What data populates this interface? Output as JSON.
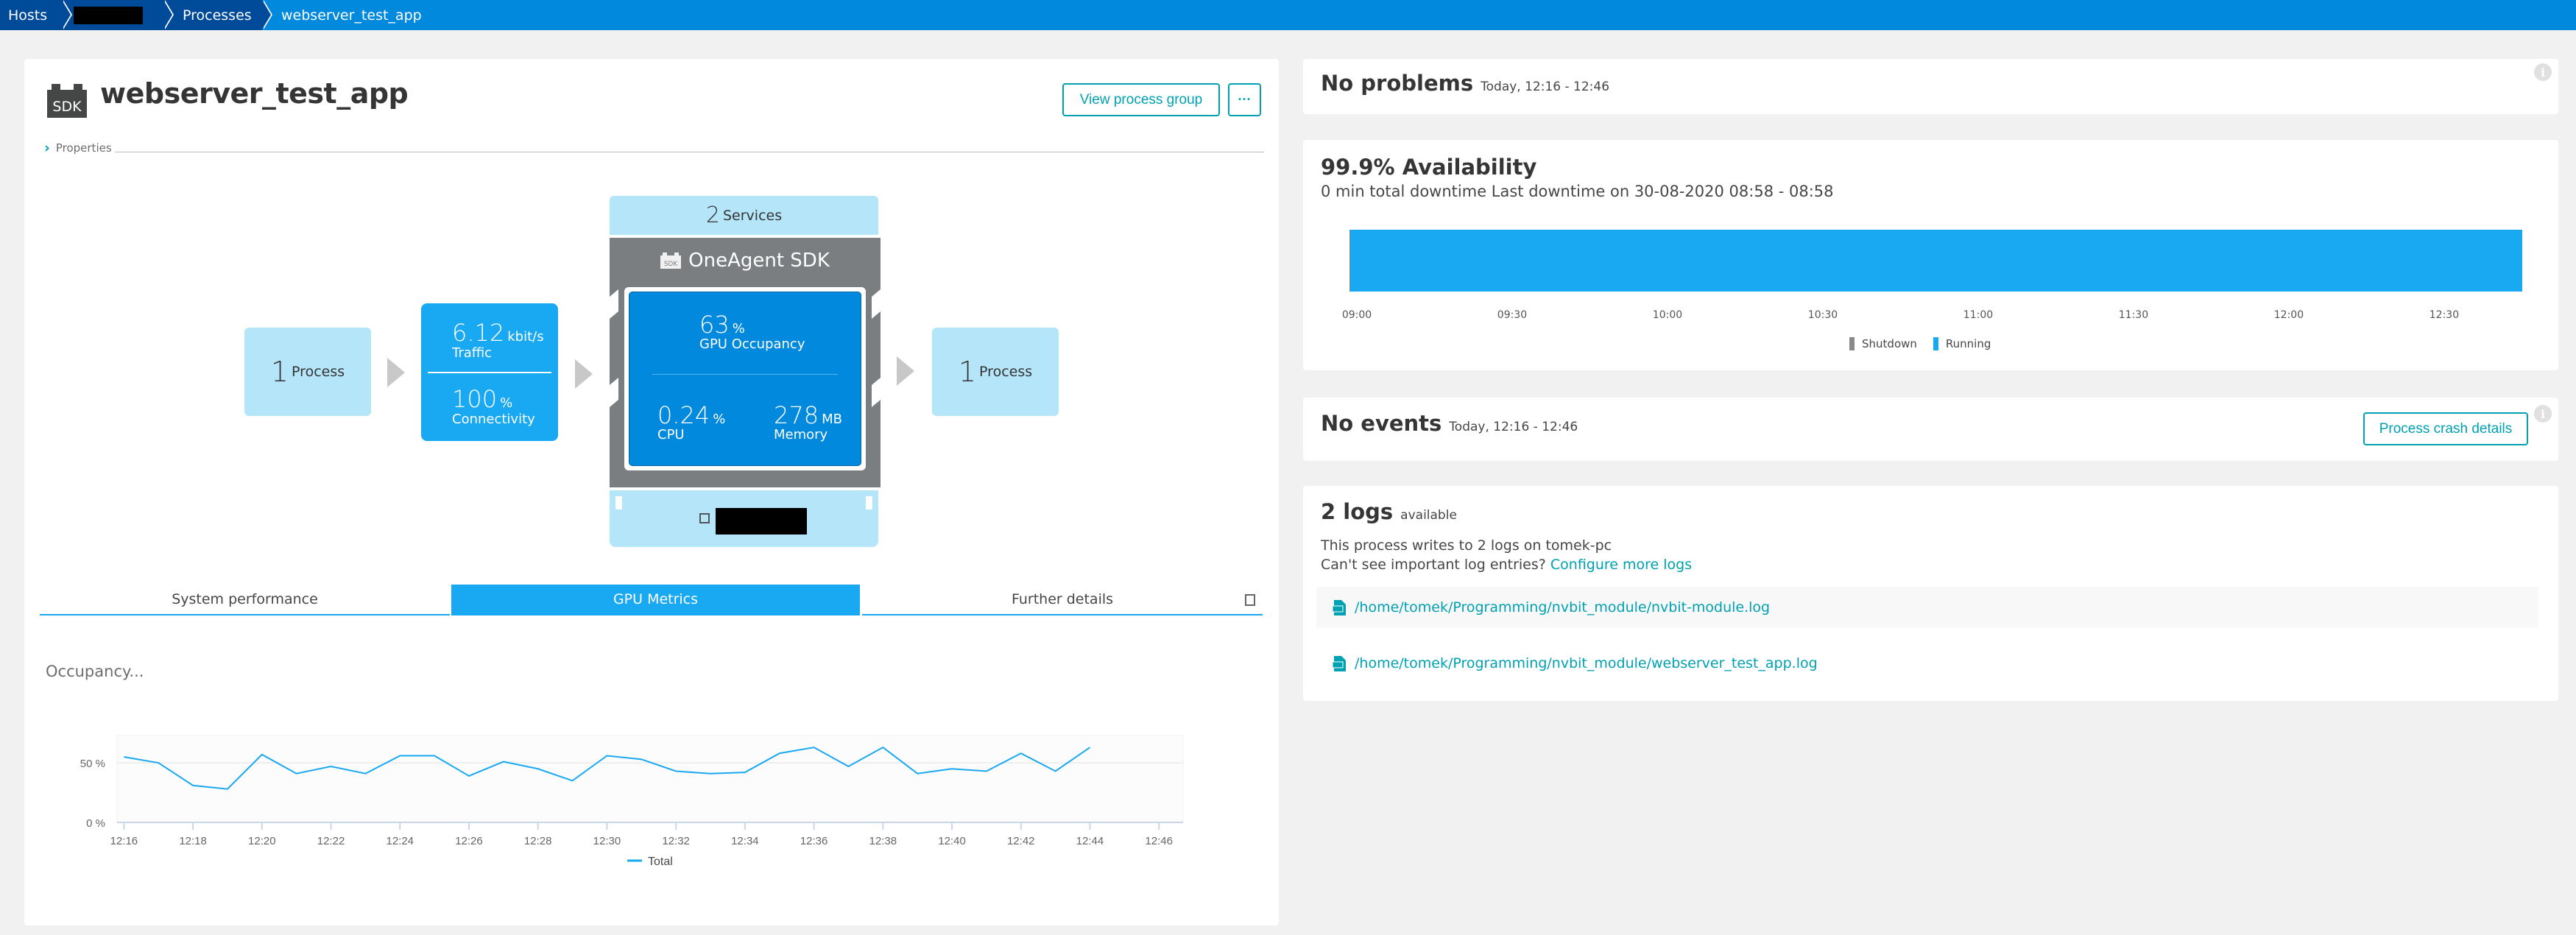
{
  "breadcrumb": {
    "items": [
      {
        "label": "Hosts"
      },
      {
        "label": "",
        "redacted": true
      },
      {
        "label": "Processes"
      },
      {
        "label": "webserver_test_app",
        "current": true
      }
    ]
  },
  "header": {
    "icon": "sdk-icon",
    "title": "webserver_test_app",
    "view_process_group_label": "View process group",
    "more_label": "···",
    "properties_label": "Properties"
  },
  "infographic": {
    "incoming": {
      "count": "1",
      "label": "Process"
    },
    "traffic": {
      "value": "6.12",
      "unit": "kbit/s",
      "label": "Traffic"
    },
    "connectivity": {
      "value": "100",
      "unit": "%",
      "label": "Connectivity"
    },
    "services": {
      "count": "2",
      "label": "Services"
    },
    "technology": {
      "name": "OneAgent SDK",
      "icon_text": "SDK"
    },
    "gpu_occupancy": {
      "value": "63",
      "unit": "%",
      "label": "GPU Occupancy"
    },
    "cpu": {
      "value": "0.24",
      "unit": "%",
      "label": "CPU"
    },
    "memory": {
      "value": "278",
      "unit": "MB",
      "label": "Memory"
    },
    "outgoing": {
      "count": "1",
      "label": "Process"
    },
    "host": {
      "redacted": true
    }
  },
  "tabs": [
    {
      "label": "System performance",
      "active": false
    },
    {
      "label": "GPU Metrics",
      "active": true
    },
    {
      "label": "Further details",
      "active": false
    }
  ],
  "colors": {
    "accent": "#19a8f2",
    "dark_accent": "#0089dd",
    "link": "#00a1b2",
    "light_box": "#b4e5f9",
    "shutdown": "#898989",
    "running": "#19a8f2"
  },
  "chart_data": [
    {
      "type": "line",
      "title": "Occupancy...",
      "xlabel": "",
      "ylabel": "",
      "x": [
        "12:16",
        "12:17",
        "12:18",
        "12:19",
        "12:20",
        "12:21",
        "12:22",
        "12:23",
        "12:24",
        "12:25",
        "12:26",
        "12:27",
        "12:28",
        "12:29",
        "12:30",
        "12:31",
        "12:32",
        "12:33",
        "12:34",
        "12:35",
        "12:36",
        "12:37",
        "12:38",
        "12:39",
        "12:40",
        "12:41",
        "12:42",
        "12:43",
        "12:44"
      ],
      "series": [
        {
          "name": "Total",
          "values": [
            55,
            50,
            31,
            28,
            57,
            41,
            47,
            41,
            56,
            56,
            39,
            51,
            45,
            35,
            56,
            53,
            43,
            41,
            42,
            58,
            63,
            47,
            63,
            41,
            45,
            43,
            58,
            43,
            63
          ]
        }
      ],
      "xticks": [
        "12:16",
        "12:18",
        "12:20",
        "12:22",
        "12:24",
        "12:26",
        "12:28",
        "12:30",
        "12:32",
        "12:34",
        "12:36",
        "12:38",
        "12:40",
        "12:42",
        "12:44",
        "12:46"
      ],
      "yticks": [
        "0 %",
        "50 %"
      ],
      "ylim": [
        0,
        73
      ],
      "xlim": [
        "12:15.8",
        "12:46.7"
      ],
      "grid": true,
      "legend": "bottom-center"
    },
    {
      "type": "bar",
      "title": "Availability",
      "series": [
        {
          "name": "Shutdown",
          "values": []
        },
        {
          "name": "Running",
          "values": [
            {
              "from": "08:58",
              "to": "12:46"
            }
          ]
        }
      ],
      "xticks": [
        "09:00",
        "09:30",
        "10:00",
        "10:30",
        "11:00",
        "11:30",
        "12:00",
        "12:30"
      ],
      "legend": "bottom-center"
    }
  ],
  "problems": {
    "title": "No problems",
    "range": "Today, 12:16 - 12:46"
  },
  "availability": {
    "title": "99.9% Availability",
    "subtitle": "0 min total downtime Last downtime on 30-08-2020 08:58 - 08:58",
    "legend": [
      {
        "label": "Shutdown"
      },
      {
        "label": "Running"
      }
    ]
  },
  "events": {
    "title": "No events",
    "range": "Today, 12:16 - 12:46",
    "crash_button": "Process crash details"
  },
  "logs": {
    "title": "2 logs",
    "suffix": "available",
    "description": "This process writes to 2 logs on tomek-pc",
    "question": "Can't see important log entries?",
    "configure_link": "Configure more logs",
    "files": [
      {
        "path": "/home/tomek/Programming/nvbit_module/nvbit-module.log"
      },
      {
        "path": "/home/tomek/Programming/nvbit_module/webserver_test_app.log"
      }
    ]
  }
}
